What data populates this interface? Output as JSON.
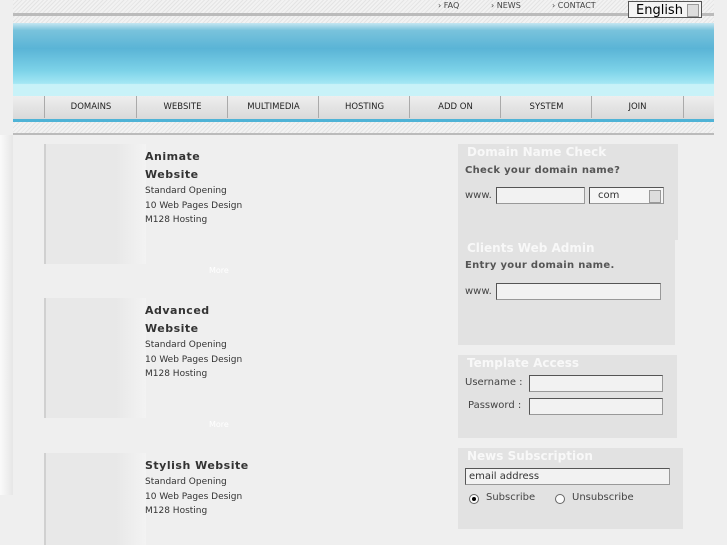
{
  "top_links": [
    "FAQ",
    "NEWS",
    "CONTACT"
  ],
  "language": "English",
  "nav": [
    "DOMAINS",
    "WEBSITE",
    "MULTIMEDIA",
    "HOSTING",
    "ADD ON",
    "SYSTEM",
    "JOIN"
  ],
  "products": [
    {
      "title1": "Animate",
      "title2": "Website",
      "lines": [
        "Standard Opening",
        "10 Web Pages Design",
        "M128 Hosting"
      ],
      "more": "More"
    },
    {
      "title1": "Advanced",
      "title2": "Website",
      "lines": [
        "Standard Opening",
        "10 Web Pages Design",
        "M128 Hosting"
      ],
      "more": "More"
    },
    {
      "title1": "Stylish Website",
      "lines": [
        "Standard Opening",
        "10 Web Pages Design",
        "M128 Hosting"
      ]
    }
  ],
  "domain_check": {
    "title": "Domain Name Check",
    "prompt": "Check your domain name?",
    "prefix": "www.",
    "input": "",
    "tld": "com"
  },
  "clients_admin": {
    "title": "Clients Web Admin",
    "prompt": "Entry your domain name.",
    "prefix": "www.",
    "input": ""
  },
  "template_access": {
    "title": "Template Access",
    "username_label": "Username :",
    "password_label": "Password :"
  },
  "news": {
    "title": "News Subscription",
    "email": "email address",
    "subscribe": "Subscribe",
    "unsubscribe": "Unsubscribe",
    "selected": "Subscribe"
  }
}
